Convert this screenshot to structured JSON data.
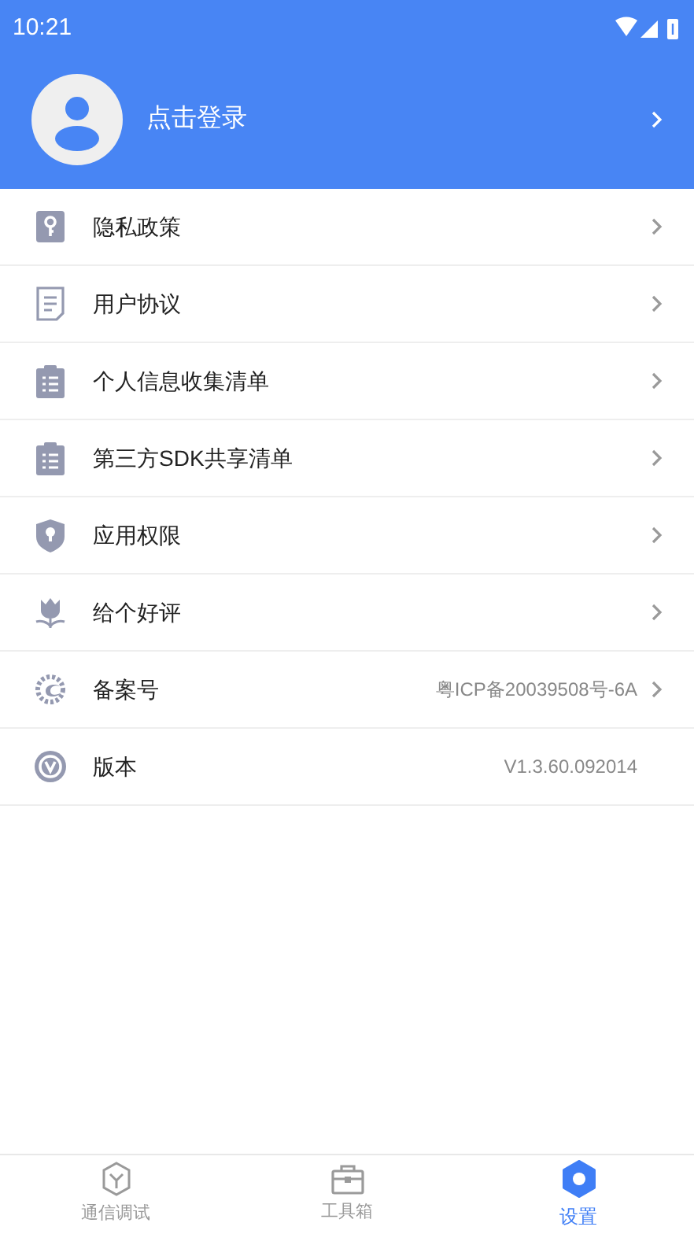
{
  "status_bar": {
    "time": "10:21"
  },
  "profile": {
    "login_label": "点击登录"
  },
  "menu": [
    {
      "kind": "privacy",
      "label": "隐私政策",
      "arrow": true
    },
    {
      "kind": "agreement",
      "label": "用户协议",
      "arrow": true
    },
    {
      "kind": "checklist",
      "label": "个人信息收集清单",
      "arrow": true
    },
    {
      "kind": "checklist",
      "label": "第三方SDK共享清单",
      "arrow": true
    },
    {
      "kind": "permission",
      "label": "应用权限",
      "arrow": true
    },
    {
      "kind": "rating",
      "label": "给个好评",
      "arrow": true
    },
    {
      "kind": "record",
      "label": "备案号",
      "value": "粤ICP备20039508号-6A",
      "arrow": true
    },
    {
      "kind": "version",
      "label": "版本",
      "value": "V1.3.60.092014",
      "arrow": false
    }
  ],
  "tabs": [
    {
      "kind": "debug",
      "label": "通信调试",
      "selected": false
    },
    {
      "kind": "toolbox",
      "label": "工具箱",
      "selected": false
    },
    {
      "kind": "settings",
      "label": "设置",
      "selected": true
    }
  ]
}
